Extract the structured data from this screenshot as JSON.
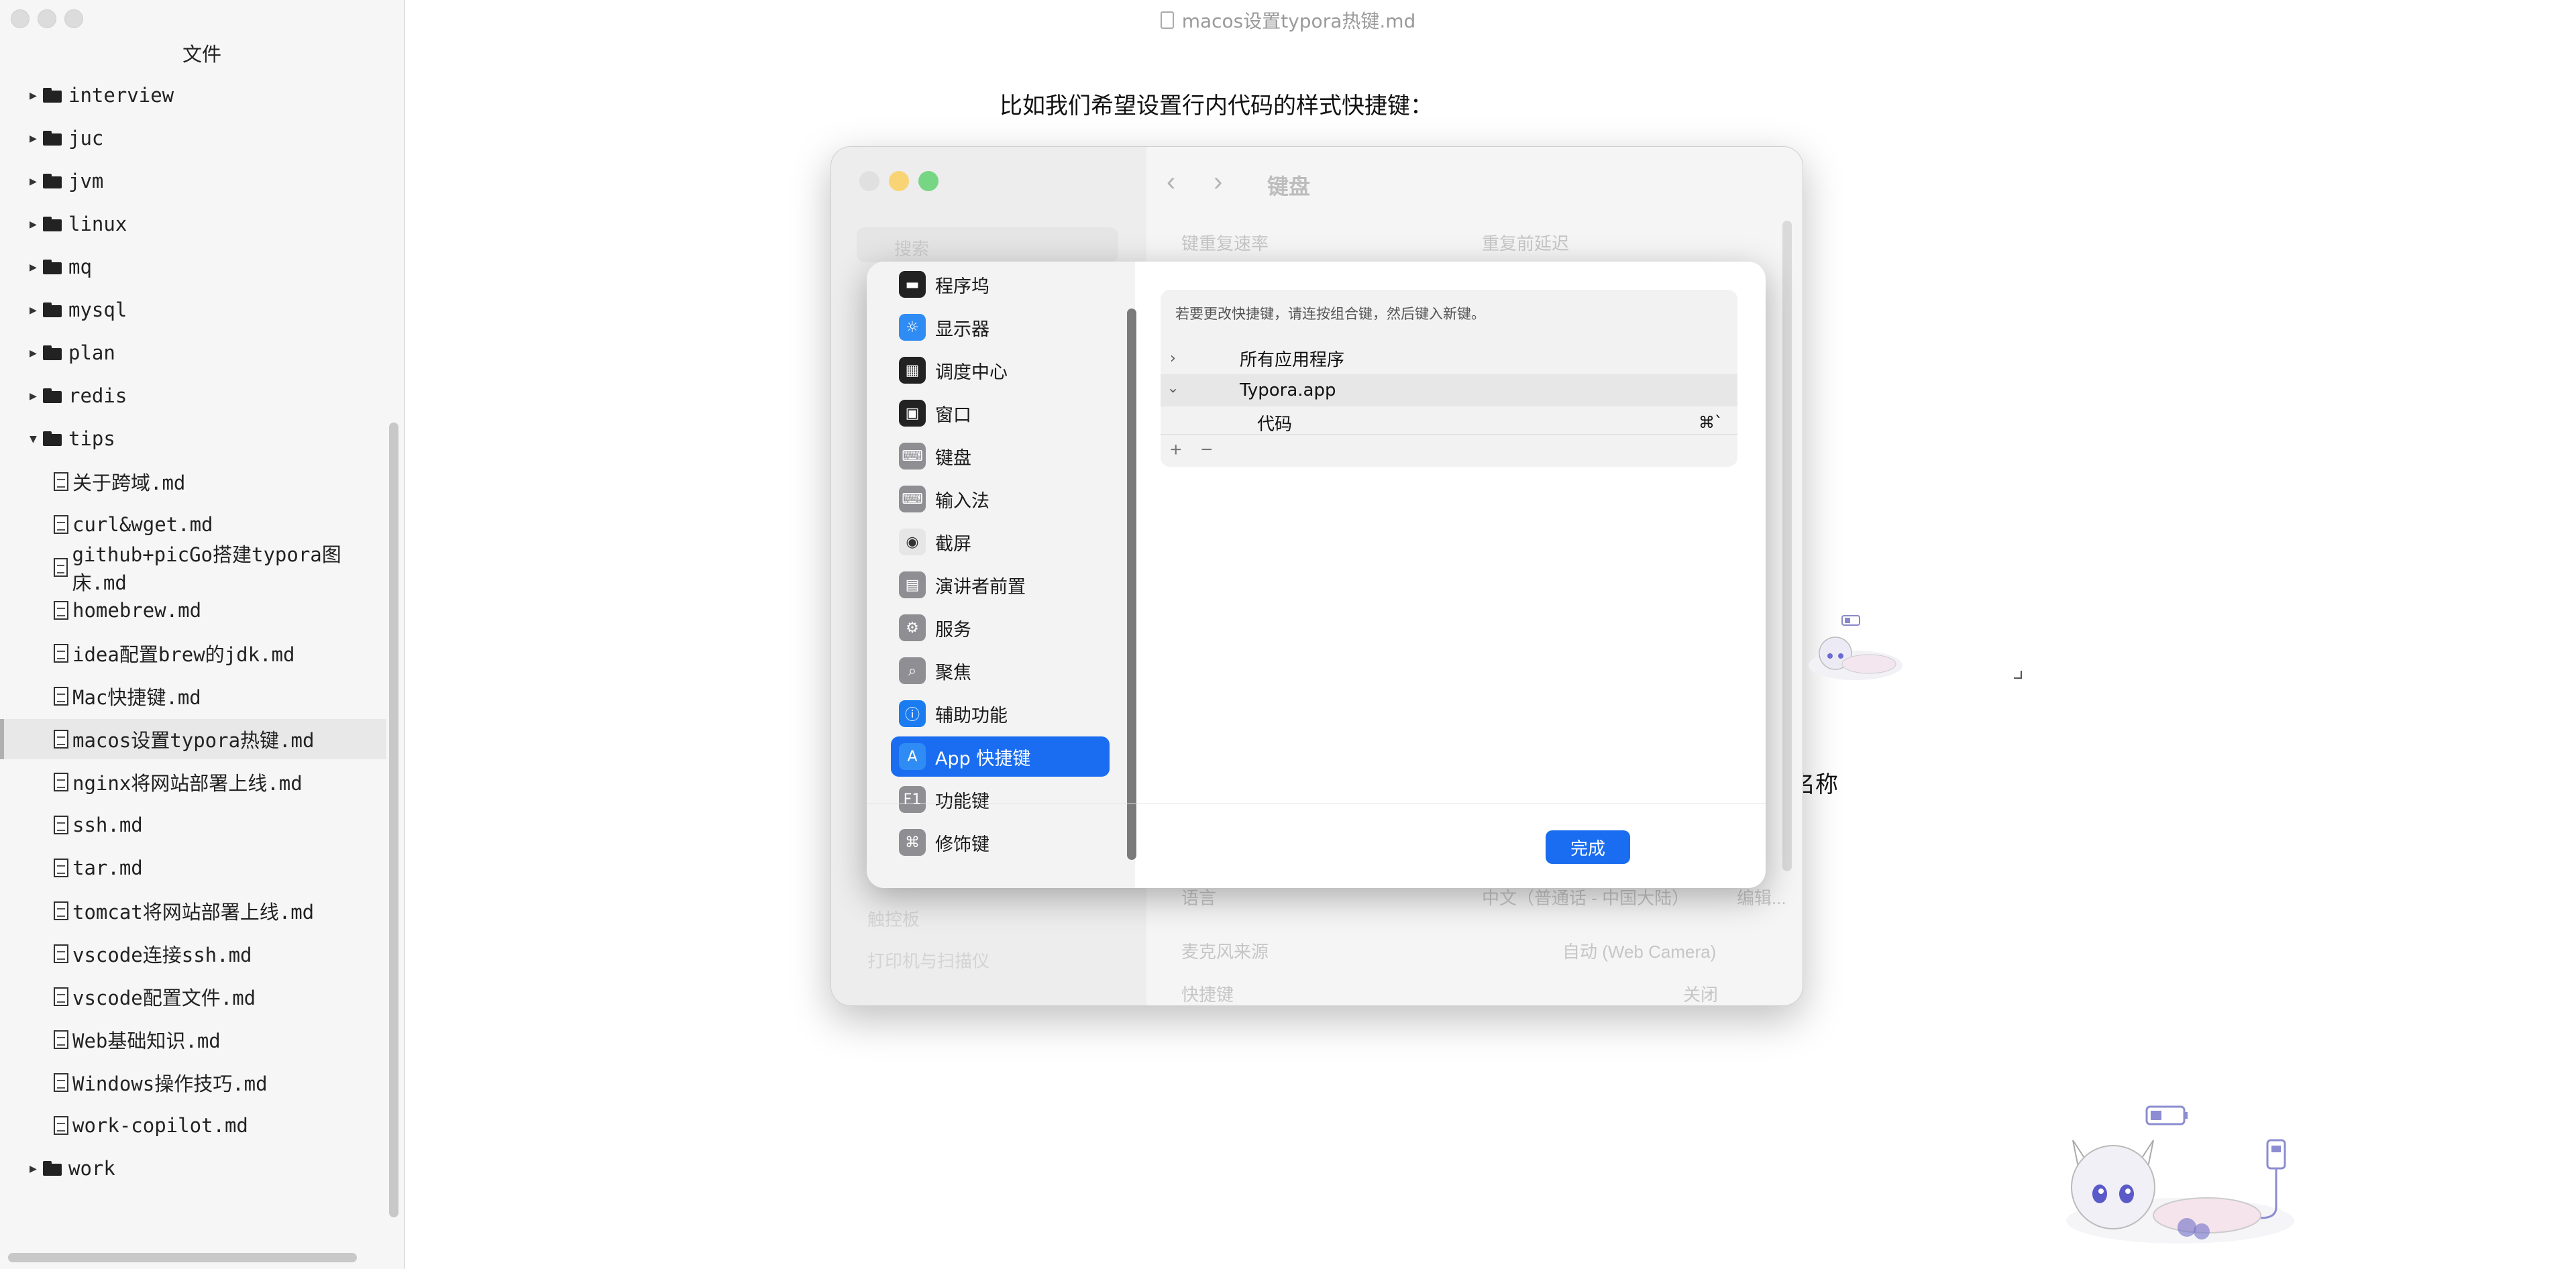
{
  "sidebar": {
    "title": "文件",
    "tree": [
      {
        "type": "folder",
        "label": "interview",
        "open": false
      },
      {
        "type": "folder",
        "label": "juc",
        "open": false
      },
      {
        "type": "folder",
        "label": "jvm",
        "open": false
      },
      {
        "type": "folder",
        "label": "linux",
        "open": false
      },
      {
        "type": "folder",
        "label": "mq",
        "open": false
      },
      {
        "type": "folder",
        "label": "mysql",
        "open": false
      },
      {
        "type": "folder",
        "label": "plan",
        "open": false
      },
      {
        "type": "folder",
        "label": "redis",
        "open": false
      },
      {
        "type": "folder",
        "label": "tips",
        "open": true
      },
      {
        "type": "file",
        "label": "关于跨域.md"
      },
      {
        "type": "file",
        "label": "curl&wget.md"
      },
      {
        "type": "file",
        "label": "github+picGo搭建typora图床.md"
      },
      {
        "type": "file",
        "label": "homebrew.md"
      },
      {
        "type": "file",
        "label": "idea配置brew的jdk.md"
      },
      {
        "type": "file",
        "label": "Mac快捷键.md"
      },
      {
        "type": "file",
        "label": "macos设置typora热键.md",
        "selected": true
      },
      {
        "type": "file",
        "label": "nginx将网站部署上线.md"
      },
      {
        "type": "file",
        "label": "ssh.md"
      },
      {
        "type": "file",
        "label": "tar.md"
      },
      {
        "type": "file",
        "label": "tomcat将网站部署上线.md"
      },
      {
        "type": "file",
        "label": "vscode连接ssh.md"
      },
      {
        "type": "file",
        "label": "vscode配置文件.md"
      },
      {
        "type": "file",
        "label": "Web基础知识.md"
      },
      {
        "type": "file",
        "label": "Windows操作技巧.md"
      },
      {
        "type": "file",
        "label": "work-copilot.md"
      },
      {
        "type": "folder",
        "label": "work",
        "open": false
      }
    ]
  },
  "document": {
    "title": "macos设置typora热键.md",
    "paragraph": "比如我们希望设置行内代码的样式快捷键：",
    "fragment_text": "名称"
  },
  "settings_window": {
    "heading": "键盘",
    "search_placeholder": "搜索",
    "rows": {
      "key_repeat": "键重复速率",
      "delay": "重复前延迟",
      "language": "语言",
      "language_value": "中文（普通话 - 中国大陆）",
      "edit": "编辑...",
      "mic_source": "麦克风来源",
      "mic_value": "自动 (Web Camera)",
      "shortcut": "快捷键",
      "shortcut_value": "关闭"
    },
    "side_items": {
      "trackpad": "触控板",
      "printers": "打印机与扫描仪"
    }
  },
  "shortcut_sheet": {
    "categories": [
      {
        "label": "程序坞",
        "icon": "dock-icon",
        "color": "#222222"
      },
      {
        "label": "显示器",
        "icon": "display-icon",
        "color": "#2f8cf5"
      },
      {
        "label": "调度中心",
        "icon": "mission-control-icon",
        "color": "#222222"
      },
      {
        "label": "窗口",
        "icon": "window-icon",
        "color": "#222222"
      },
      {
        "label": "键盘",
        "icon": "keyboard-icon",
        "color": "#8e8e93"
      },
      {
        "label": "输入法",
        "icon": "input-method-icon",
        "color": "#8e8e93"
      },
      {
        "label": "截屏",
        "icon": "screenshot-icon",
        "color": "#e6e6e6"
      },
      {
        "label": "演讲者前置",
        "icon": "presenter-icon",
        "color": "#8e8e93"
      },
      {
        "label": "服务",
        "icon": "services-icon",
        "color": "#8e8e93"
      },
      {
        "label": "聚焦",
        "icon": "spotlight-icon",
        "color": "#8e8e93"
      },
      {
        "label": "辅助功能",
        "icon": "accessibility-icon",
        "color": "#1a7cf0"
      },
      {
        "label": "App 快捷键",
        "icon": "app-store-icon",
        "color": "#2f8cf5",
        "active": true
      },
      {
        "label": "功能键",
        "icon": "function-key-icon",
        "color": "#8e8e93"
      },
      {
        "label": "修饰键",
        "icon": "command-key-icon",
        "color": "#8e8e93"
      }
    ],
    "hint": "若要更改快捷键，请连按组合键，然后键入新键。",
    "rows": [
      {
        "label": "所有应用程序",
        "expanded": false
      },
      {
        "label": "Typora.app",
        "expanded": true
      },
      {
        "label": "代码",
        "key": "⌘`"
      }
    ],
    "add_label": "+",
    "remove_label": "−",
    "done_label": "完成"
  }
}
